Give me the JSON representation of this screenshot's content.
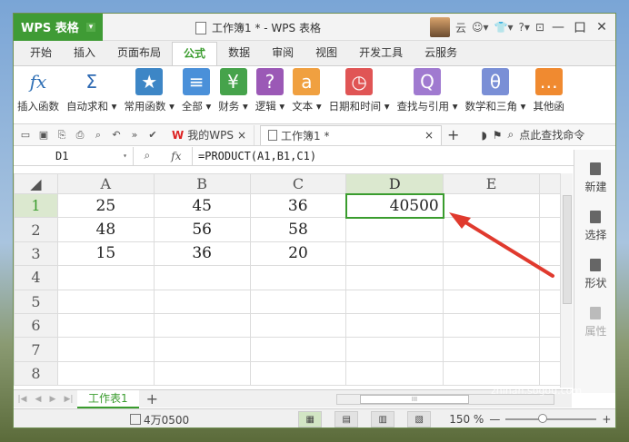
{
  "app": {
    "name": "WPS 表格",
    "window_title": "工作簿1 * - WPS 表格",
    "user_name": "云"
  },
  "window_controls": {
    "minimize": "—",
    "maximize": "口",
    "close": "✕"
  },
  "menu": [
    {
      "label": "开始"
    },
    {
      "label": "插入"
    },
    {
      "label": "页面布局"
    },
    {
      "label": "公式",
      "active": true
    },
    {
      "label": "数据"
    },
    {
      "label": "审阅"
    },
    {
      "label": "视图"
    },
    {
      "label": "开发工具"
    },
    {
      "label": "云服务"
    }
  ],
  "ribbon": [
    {
      "label": "插入函数",
      "icon": "fx-icon",
      "glyph": "fx",
      "color": "#2e6fb5"
    },
    {
      "label": "自动求和 ▾",
      "icon": "sigma-icon",
      "glyph": "Σ",
      "color": "#2f6ab3"
    },
    {
      "label": "常用函数 ▾",
      "icon": "star-icon",
      "glyph": "★",
      "color": "#3d86c6"
    },
    {
      "label": "全部 ▾",
      "icon": "list-icon",
      "glyph": "≡",
      "color": "#4a90d9"
    },
    {
      "label": "财务 ▾",
      "icon": "finance-icon",
      "glyph": "¥",
      "color": "#46a34b"
    },
    {
      "label": "逻辑 ▾",
      "icon": "logic-icon",
      "glyph": "?",
      "color": "#9b59b6"
    },
    {
      "label": "文本 ▾",
      "icon": "text-icon",
      "glyph": "a",
      "color": "#f0a040"
    },
    {
      "label": "日期和时间 ▾",
      "icon": "clock-icon",
      "glyph": "◷",
      "color": "#e05555"
    },
    {
      "label": "查找与引用 ▾",
      "icon": "lookup-icon",
      "glyph": "Q",
      "color": "#a07ad0"
    },
    {
      "label": "数学和三角 ▾",
      "icon": "math-icon",
      "glyph": "θ",
      "color": "#7a8fd6"
    },
    {
      "label": "其他函",
      "icon": "more-icon",
      "glyph": "…",
      "color": "#f08a30"
    }
  ],
  "doc_tabs": {
    "wps_tab": "我的WPS",
    "doc_tab": "工作簿1 *",
    "search": "点此查找命令"
  },
  "formula_bar": {
    "name_box": "D1",
    "formula": "=PRODUCT(A1,B1,C1)"
  },
  "grid": {
    "columns": [
      "A",
      "B",
      "C",
      "D",
      "E"
    ],
    "rows": [
      {
        "num": "1",
        "cells": [
          "25",
          "45",
          "36",
          "40500",
          ""
        ]
      },
      {
        "num": "2",
        "cells": [
          "48",
          "56",
          "58",
          "",
          ""
        ]
      },
      {
        "num": "3",
        "cells": [
          "15",
          "36",
          "20",
          "",
          ""
        ]
      },
      {
        "num": "4",
        "cells": [
          "",
          "",
          "",
          "",
          ""
        ]
      },
      {
        "num": "5",
        "cells": [
          "",
          "",
          "",
          "",
          ""
        ]
      },
      {
        "num": "6",
        "cells": [
          "",
          "",
          "",
          "",
          ""
        ]
      },
      {
        "num": "7",
        "cells": [
          "",
          "",
          "",
          "",
          ""
        ]
      },
      {
        "num": "8",
        "cells": [
          "",
          "",
          "",
          "",
          ""
        ]
      }
    ]
  },
  "side_panel": [
    {
      "label": "新建",
      "icon": "new-icon"
    },
    {
      "label": "选择",
      "icon": "select-icon"
    },
    {
      "label": "形状",
      "icon": "shape-icon"
    },
    {
      "label": "属性",
      "icon": "property-icon",
      "dim": true
    }
  ],
  "sheet": {
    "name": "工作表1"
  },
  "status": {
    "sum_text": "4万0500",
    "zoom": "150 %"
  },
  "watermark": {
    "brand": "搜狗指南",
    "url": "zhinan.sogou.com"
  },
  "colors": {
    "accent": "#3a9c2e",
    "arrow": "#e03a2e"
  }
}
